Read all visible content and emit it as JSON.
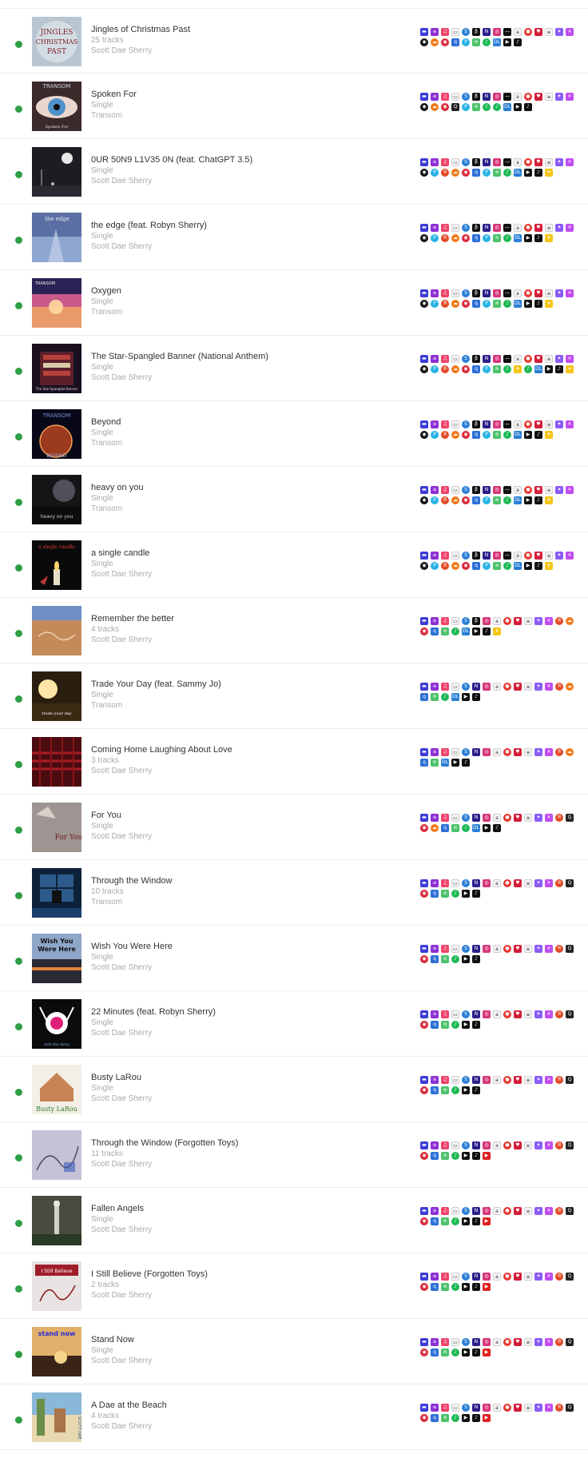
{
  "releases": [
    {
      "title": "Jingles of Christmas Past",
      "kind": "25 tracks",
      "artist": "Scott Dae Sherry",
      "art": "christmas",
      "platforms": [
        "amazon",
        "deezer",
        "apple-music",
        "gaana",
        "shazam",
        "beatport",
        "napster",
        "instagram",
        "tidal",
        "anghami",
        "boomplay",
        "iheart",
        "jiosaavn",
        "joox",
        "kkbox",
        "fanlink",
        "soundcloud",
        "netease",
        "qobuz",
        "pandora",
        "audiomack",
        "spotify",
        "claro",
        "youtube-music",
        "tiktok"
      ]
    },
    {
      "title": "Spoken For",
      "kind": "Single",
      "artist": "Transom",
      "art": "eye",
      "platforms": [
        "amazon",
        "deezer",
        "apple-music",
        "gaana",
        "shazam",
        "beatport",
        "napster",
        "instagram",
        "tidal",
        "anghami",
        "boomplay",
        "iheart",
        "jiosaavn",
        "joox",
        "kkbox",
        "fanlink",
        "soundcloud",
        "netease",
        "tencent",
        "pandora",
        "audiomack",
        "spotify",
        "spotify",
        "claro",
        "youtube-music",
        "tiktok"
      ]
    },
    {
      "title": "0UR 50N9 L1V35 0N (feat. ChatGPT 3.5)",
      "kind": "Single",
      "artist": "Scott Dae Sherry",
      "art": "moon",
      "platforms": [
        "amazon",
        "deezer",
        "apple-music",
        "gaana",
        "shazam",
        "beatport",
        "napster",
        "instagram",
        "tidal",
        "anghami",
        "boomplay",
        "iheart",
        "jiosaavn",
        "joox",
        "kkbox",
        "fanlink",
        "pandora",
        "yandex",
        "soundcloud",
        "netease",
        "qobuz",
        "pandora",
        "audiomack",
        "spotify",
        "claro",
        "youtube-music",
        "tiktok",
        "snapchat"
      ]
    },
    {
      "title": "the edge (feat. Robyn Sherry)",
      "kind": "Single",
      "artist": "Scott Dae Sherry",
      "art": "edge",
      "platforms": [
        "amazon",
        "deezer",
        "apple-music",
        "gaana",
        "shazam",
        "beatport",
        "napster",
        "instagram",
        "tidal",
        "anghami",
        "boomplay",
        "iheart",
        "jiosaavn",
        "joox",
        "kkbox",
        "fanlink",
        "pandora",
        "yandex",
        "soundcloud",
        "netease",
        "qobuz",
        "pandora",
        "audiomack",
        "spotify",
        "claro",
        "youtube-music",
        "tiktok",
        "snapchat"
      ]
    },
    {
      "title": "Oxygen",
      "kind": "Single",
      "artist": "Transom",
      "art": "sunset",
      "platforms": [
        "amazon",
        "deezer",
        "apple-music",
        "gaana",
        "shazam",
        "beatport",
        "napster",
        "instagram",
        "tidal",
        "anghami",
        "boomplay",
        "iheart",
        "jiosaavn",
        "joox",
        "kkbox",
        "fanlink",
        "pandora",
        "yandex",
        "soundcloud",
        "netease",
        "qobuz",
        "pandora",
        "audiomack",
        "spotify",
        "claro",
        "youtube-music",
        "tiktok",
        "snapchat"
      ]
    },
    {
      "title": "The Star-Spangled Banner (National Anthem)",
      "kind": "Single",
      "artist": "Scott Dae Sherry",
      "art": "banner",
      "platforms": [
        "amazon",
        "deezer",
        "apple-music",
        "gaana",
        "shazam",
        "beatport",
        "napster",
        "instagram",
        "tidal",
        "anghami",
        "boomplay",
        "iheart",
        "jiosaavn",
        "joox",
        "kkbox",
        "fanlink",
        "pandora",
        "yandex",
        "soundcloud",
        "netease",
        "qobuz",
        "pandora",
        "audiomack",
        "spotify",
        "snapchat",
        "spotify",
        "claro",
        "youtube-music",
        "tiktok",
        "snapchat"
      ]
    },
    {
      "title": "Beyond",
      "kind": "Single",
      "artist": "Transom",
      "art": "planet",
      "platforms": [
        "amazon",
        "deezer",
        "apple-music",
        "gaana",
        "shazam",
        "beatport",
        "napster",
        "instagram",
        "tidal",
        "anghami",
        "boomplay",
        "iheart",
        "jiosaavn",
        "joox",
        "kkbox",
        "fanlink",
        "pandora",
        "yandex",
        "soundcloud",
        "netease",
        "qobuz",
        "pandora",
        "audiomack",
        "spotify",
        "claro",
        "youtube-music",
        "tiktok",
        "snapchat"
      ]
    },
    {
      "title": "heavy on you",
      "kind": "Single",
      "artist": "Transom",
      "art": "storm",
      "platforms": [
        "amazon",
        "deezer",
        "apple-music",
        "gaana",
        "shazam",
        "beatport",
        "napster",
        "instagram",
        "tidal",
        "anghami",
        "boomplay",
        "iheart",
        "jiosaavn",
        "joox",
        "kkbox",
        "fanlink",
        "pandora",
        "yandex",
        "soundcloud",
        "netease",
        "qobuz",
        "pandora",
        "audiomack",
        "spotify",
        "claro",
        "youtube-music",
        "tiktok",
        "snapchat"
      ]
    },
    {
      "title": "a single candle",
      "kind": "Single",
      "artist": "Scott Dae Sherry",
      "art": "candle",
      "platforms": [
        "amazon",
        "deezer",
        "apple-music",
        "gaana",
        "shazam",
        "beatport",
        "napster",
        "instagram",
        "tidal",
        "anghami",
        "boomplay",
        "iheart",
        "jiosaavn",
        "joox",
        "kkbox",
        "fanlink",
        "pandora",
        "yandex",
        "soundcloud",
        "netease",
        "qobuz",
        "pandora",
        "audiomack",
        "spotify",
        "claro",
        "youtube-music",
        "tiktok",
        "snapchat"
      ]
    },
    {
      "title": "Remember the better",
      "kind": "4 tracks",
      "artist": "Scott Dae Sherry",
      "art": "sand",
      "platforms": [
        "amazon",
        "deezer",
        "apple-music",
        "gaana",
        "shazam",
        "beatport",
        "instagram",
        "anghami",
        "boomplay",
        "iheart",
        "jiosaavn",
        "joox",
        "kkbox",
        "yandex",
        "soundcloud",
        "netease",
        "qobuz",
        "audiomack",
        "spotify",
        "claro",
        "youtube-music",
        "tiktok",
        "snapchat"
      ]
    },
    {
      "title": "Trade Your Day (feat. Sammy Jo)",
      "kind": "Single",
      "artist": "Transom",
      "art": "sunrise",
      "platforms": [
        "amazon",
        "deezer",
        "apple-music",
        "gaana",
        "shazam",
        "napster",
        "instagram",
        "anghami",
        "boomplay",
        "iheart",
        "jiosaavn",
        "joox",
        "kkbox",
        "yandex",
        "soundcloud",
        "qobuz",
        "audiomack",
        "spotify",
        "claro",
        "youtube-music",
        "tiktok"
      ]
    },
    {
      "title": "Coming Home Laughing About Love",
      "kind": "3 tracks",
      "artist": "Scott Dae Sherry",
      "art": "red",
      "platforms": [
        "amazon",
        "deezer",
        "apple-music",
        "gaana",
        "shazam",
        "napster",
        "instagram",
        "anghami",
        "boomplay",
        "iheart",
        "jiosaavn",
        "joox",
        "kkbox",
        "yandex",
        "soundcloud",
        "qobuz",
        "audiomack",
        "claro",
        "youtube-music",
        "tiktok"
      ]
    },
    {
      "title": "For You",
      "kind": "Single",
      "artist": "Scott Dae Sherry",
      "art": "foryou",
      "platforms": [
        "amazon",
        "deezer",
        "apple-music",
        "gaana",
        "shazam",
        "napster",
        "instagram",
        "anghami",
        "boomplay",
        "iheart",
        "jiosaavn",
        "joox",
        "kkbox",
        "yandex",
        "tencent",
        "netease",
        "soundcloud",
        "qobuz",
        "audiomack",
        "spotify",
        "claro",
        "youtube-music",
        "tiktok"
      ]
    },
    {
      "title": "Through the Window",
      "kind": "10 tracks",
      "artist": "Transom",
      "art": "window",
      "platforms": [
        "amazon",
        "deezer",
        "apple-music",
        "gaana",
        "shazam",
        "napster",
        "instagram",
        "anghami",
        "boomplay",
        "iheart",
        "jiosaavn",
        "joox",
        "kkbox",
        "yandex",
        "tencent",
        "netease",
        "qobuz",
        "audiomack",
        "spotify",
        "youtube-music",
        "tiktok"
      ]
    },
    {
      "title": "Wish You Were Here",
      "kind": "Single",
      "artist": "Scott Dae Sherry",
      "art": "wish",
      "platforms": [
        "amazon",
        "deezer",
        "apple-music",
        "gaana",
        "shazam",
        "napster",
        "instagram",
        "anghami",
        "boomplay",
        "iheart",
        "jiosaavn",
        "joox",
        "kkbox",
        "yandex",
        "tencent",
        "netease",
        "qobuz",
        "audiomack",
        "spotify",
        "youtube-music",
        "tiktok"
      ]
    },
    {
      "title": "22 Minutes (feat. Robyn Sherry)",
      "kind": "Single",
      "artist": "Scott Dae Sherry",
      "art": "hand",
      "platforms": [
        "amazon",
        "deezer",
        "apple-music",
        "gaana",
        "shazam",
        "napster",
        "instagram",
        "anghami",
        "boomplay",
        "iheart",
        "jiosaavn",
        "joox",
        "kkbox",
        "yandex",
        "tencent",
        "netease",
        "qobuz",
        "audiomack",
        "spotify",
        "youtube-music",
        "tiktok"
      ]
    },
    {
      "title": "Busty LaRou",
      "kind": "Single",
      "artist": "Scott Dae Sherry",
      "art": "busty",
      "platforms": [
        "amazon",
        "deezer",
        "apple-music",
        "gaana",
        "shazam",
        "napster",
        "instagram",
        "anghami",
        "boomplay",
        "iheart",
        "jiosaavn",
        "joox",
        "kkbox",
        "yandex",
        "tencent",
        "netease",
        "qobuz",
        "audiomack",
        "spotify",
        "youtube-music",
        "tiktok"
      ]
    },
    {
      "title": "Through the Window (Forgotten Toys)",
      "kind": "11 tracks",
      "artist": "Scott Dae Sherry",
      "art": "sketch",
      "platforms": [
        "amazon",
        "deezer",
        "apple-music",
        "gaana",
        "shazam",
        "napster",
        "instagram",
        "anghami",
        "boomplay",
        "iheart",
        "jiosaavn",
        "joox",
        "kkbox",
        "yandex",
        "tencent",
        "netease",
        "qobuz",
        "audiomack",
        "spotify",
        "youtube-music",
        "tiktok",
        "youtube"
      ]
    },
    {
      "title": "Fallen Angels",
      "kind": "Single",
      "artist": "Scott Dae Sherry",
      "art": "angel",
      "platforms": [
        "amazon",
        "deezer",
        "apple-music",
        "gaana",
        "shazam",
        "napster",
        "instagram",
        "anghami",
        "boomplay",
        "iheart",
        "jiosaavn",
        "joox",
        "kkbox",
        "yandex",
        "tencent",
        "netease",
        "qobuz",
        "audiomack",
        "spotify",
        "youtube-music",
        "tiktok",
        "youtube"
      ]
    },
    {
      "title": "I Still Believe (Forgotten Toys)",
      "kind": "2 tracks",
      "artist": "Scott Dae Sherry",
      "art": "believe",
      "platforms": [
        "amazon",
        "deezer",
        "apple-music",
        "gaana",
        "shazam",
        "napster",
        "instagram",
        "anghami",
        "boomplay",
        "iheart",
        "jiosaavn",
        "joox",
        "kkbox",
        "yandex",
        "tencent",
        "netease",
        "qobuz",
        "audiomack",
        "spotify",
        "youtube-music",
        "tiktok",
        "youtube"
      ]
    },
    {
      "title": "Stand Now",
      "kind": "Single",
      "artist": "Scott Dae Sherry",
      "art": "standnow",
      "platforms": [
        "amazon",
        "deezer",
        "apple-music",
        "gaana",
        "shazam",
        "napster",
        "instagram",
        "anghami",
        "boomplay",
        "iheart",
        "jiosaavn",
        "joox",
        "kkbox",
        "yandex",
        "tencent",
        "netease",
        "qobuz",
        "audiomack",
        "spotify",
        "youtube-music",
        "tiktok",
        "youtube"
      ]
    },
    {
      "title": "A Dae at the Beach",
      "kind": "4 tracks",
      "artist": "Scott Dae Sherry",
      "art": "beach",
      "platforms": [
        "amazon",
        "deezer",
        "apple-music",
        "gaana",
        "shazam",
        "napster",
        "instagram",
        "anghami",
        "boomplay",
        "iheart",
        "jiosaavn",
        "joox",
        "kkbox",
        "yandex",
        "tencent",
        "netease",
        "qobuz",
        "audiomack",
        "spotify",
        "youtube-music",
        "tiktok",
        "youtube"
      ]
    }
  ],
  "platform_styles": {
    "amazon": {
      "bg": "#3d3bd6",
      "glyph": "▬"
    },
    "deezer": {
      "bg": "#8e2fd4",
      "glyph": "≡"
    },
    "apple-music": {
      "bg": "#f0446a",
      "glyph": "♫"
    },
    "gaana": {
      "bg": "#f5f5f5",
      "glyph": "▭",
      "light": true
    },
    "shazam": {
      "bg": "#2a7fd6",
      "glyph": "S",
      "round": true
    },
    "beatport": {
      "bg": "#111111",
      "glyph": "β"
    },
    "napster": {
      "bg": "#2b1f8a",
      "glyph": "N"
    },
    "instagram": {
      "bg": "#d6367a",
      "glyph": "◎"
    },
    "tidal": {
      "bg": "#111111",
      "glyph": "—"
    },
    "anghami": {
      "bg": "#f5f5f5",
      "glyph": "a",
      "light": true
    },
    "boomplay": {
      "bg": "#e6372f",
      "glyph": "●",
      "round": true
    },
    "iheart": {
      "bg": "#d31e3a",
      "glyph": "♥"
    },
    "jiosaavn": {
      "bg": "#f5f5f5",
      "glyph": "≡",
      "light": true
    },
    "joox": {
      "bg": "#8b5cf6",
      "glyph": "✦"
    },
    "kkbox": {
      "bg": "#c04cf0",
      "glyph": "✕"
    },
    "fanlink": {
      "bg": "#111111",
      "glyph": "◉",
      "round": true
    },
    "pandora": {
      "bg": "#29b3e6",
      "glyph": "P",
      "round": true
    },
    "yandex": {
      "bg": "#e34a27",
      "glyph": "Я",
      "round": true
    },
    "soundcloud": {
      "bg": "#f27a1a",
      "glyph": "☁",
      "round": true
    },
    "netease": {
      "bg": "#d9283a",
      "glyph": "◉",
      "round": true
    },
    "tencent": {
      "bg": "#222222",
      "glyph": "Q"
    },
    "qobuz": {
      "bg": "#2b6fd6",
      "glyph": "q"
    },
    "audiomack": {
      "bg": "#4cc26b",
      "glyph": "≋"
    },
    "spotify": {
      "bg": "#1db954",
      "glyph": "♪",
      "round": true
    },
    "claro": {
      "bg": "#2a7fd6",
      "glyph": "DL"
    },
    "youtube-music": {
      "bg": "#111111",
      "glyph": "▶"
    },
    "tiktok": {
      "bg": "#111111",
      "glyph": "♪"
    },
    "snapchat": {
      "bg": "#f5c518",
      "glyph": "✦"
    },
    "youtube": {
      "bg": "#e02020",
      "glyph": "▶"
    }
  }
}
